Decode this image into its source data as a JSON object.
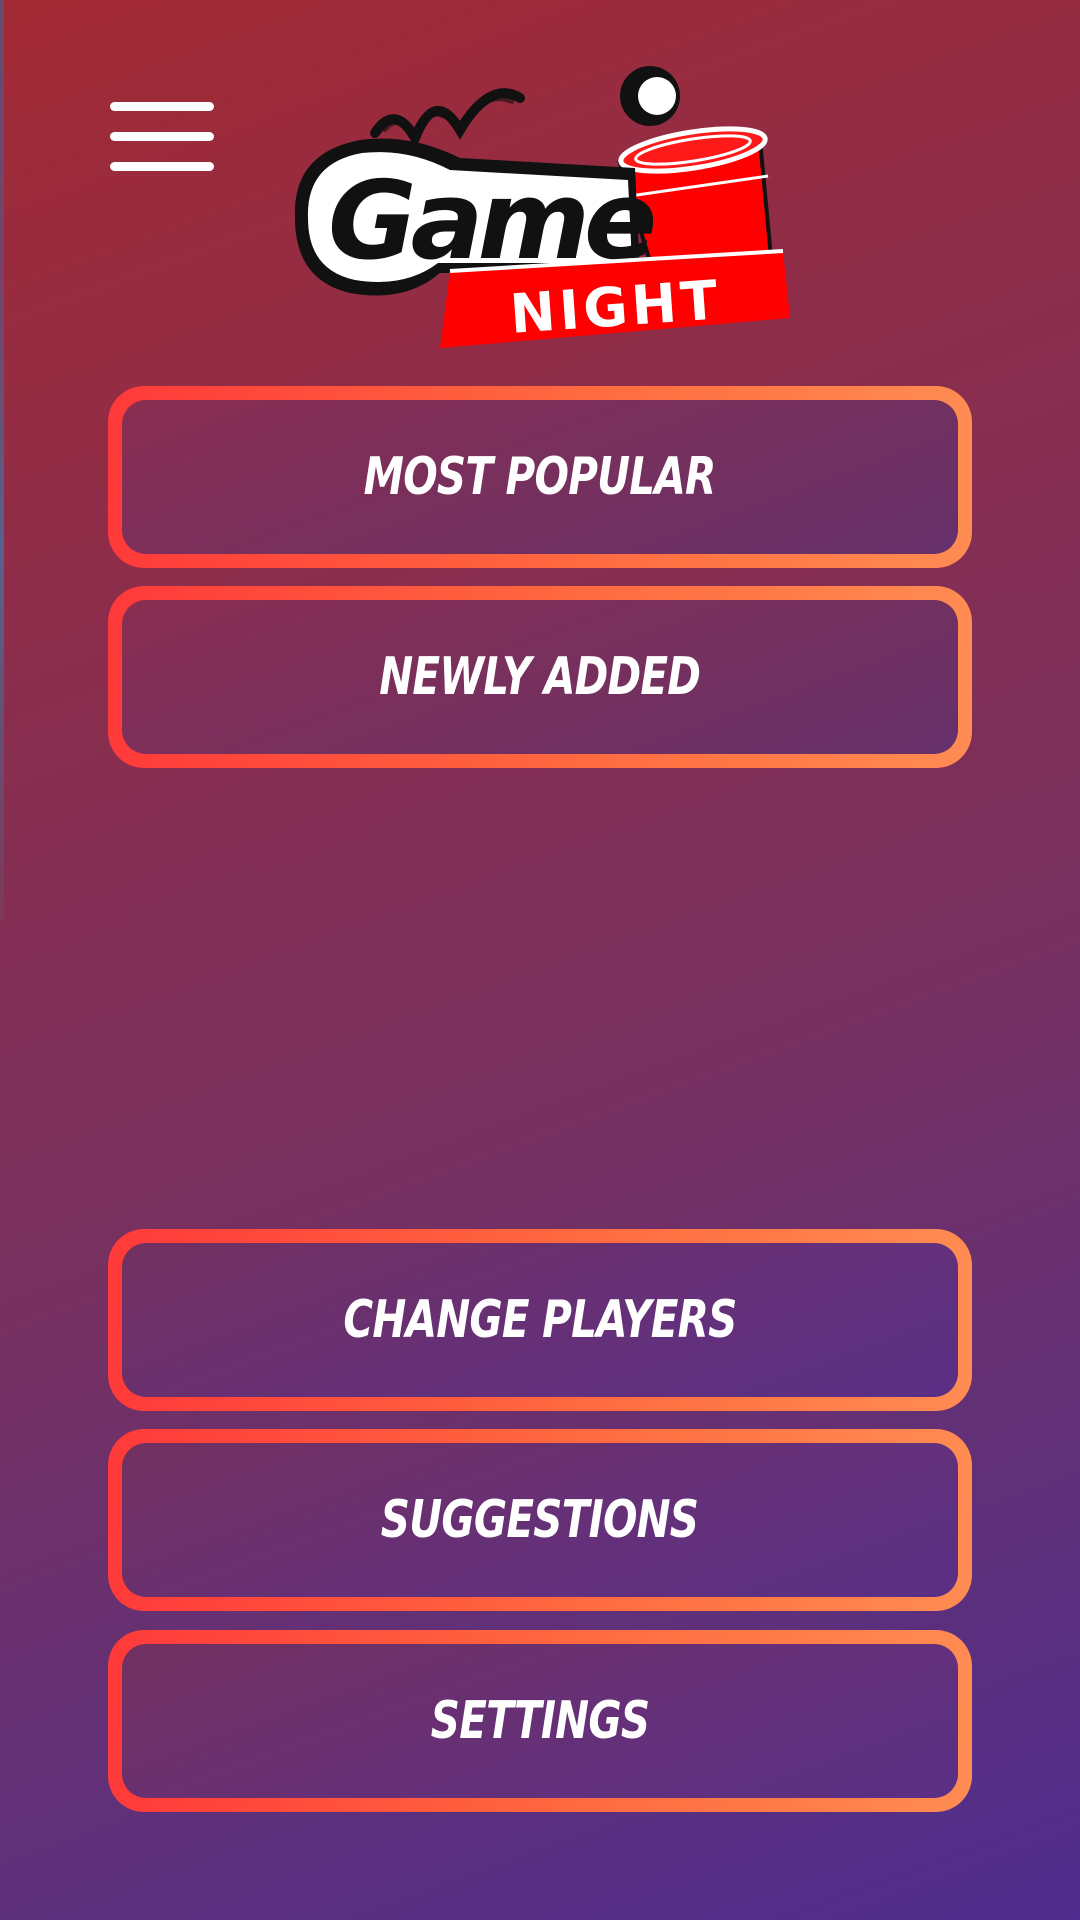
{
  "header": {
    "menu_icon": "hamburger-menu-icon",
    "logo": {
      "word_top": "Game",
      "word_bottom": "NIGHT"
    }
  },
  "menu": {
    "items": [
      {
        "label": "MOST POPULAR"
      },
      {
        "label": "NEWLY ADDED"
      },
      {
        "label": "CHANGE PLAYERS"
      },
      {
        "label": "SUGGESTIONS"
      },
      {
        "label": "SETTINGS"
      }
    ]
  },
  "colors": {
    "background_start": "#a32a34",
    "background_end": "#4f2d8e",
    "button_border_start": "#ff3a3a",
    "button_border_end": "#ff8c52",
    "button_text": "#ffffff",
    "logo_red": "#ff0000",
    "logo_black": "#111111"
  }
}
